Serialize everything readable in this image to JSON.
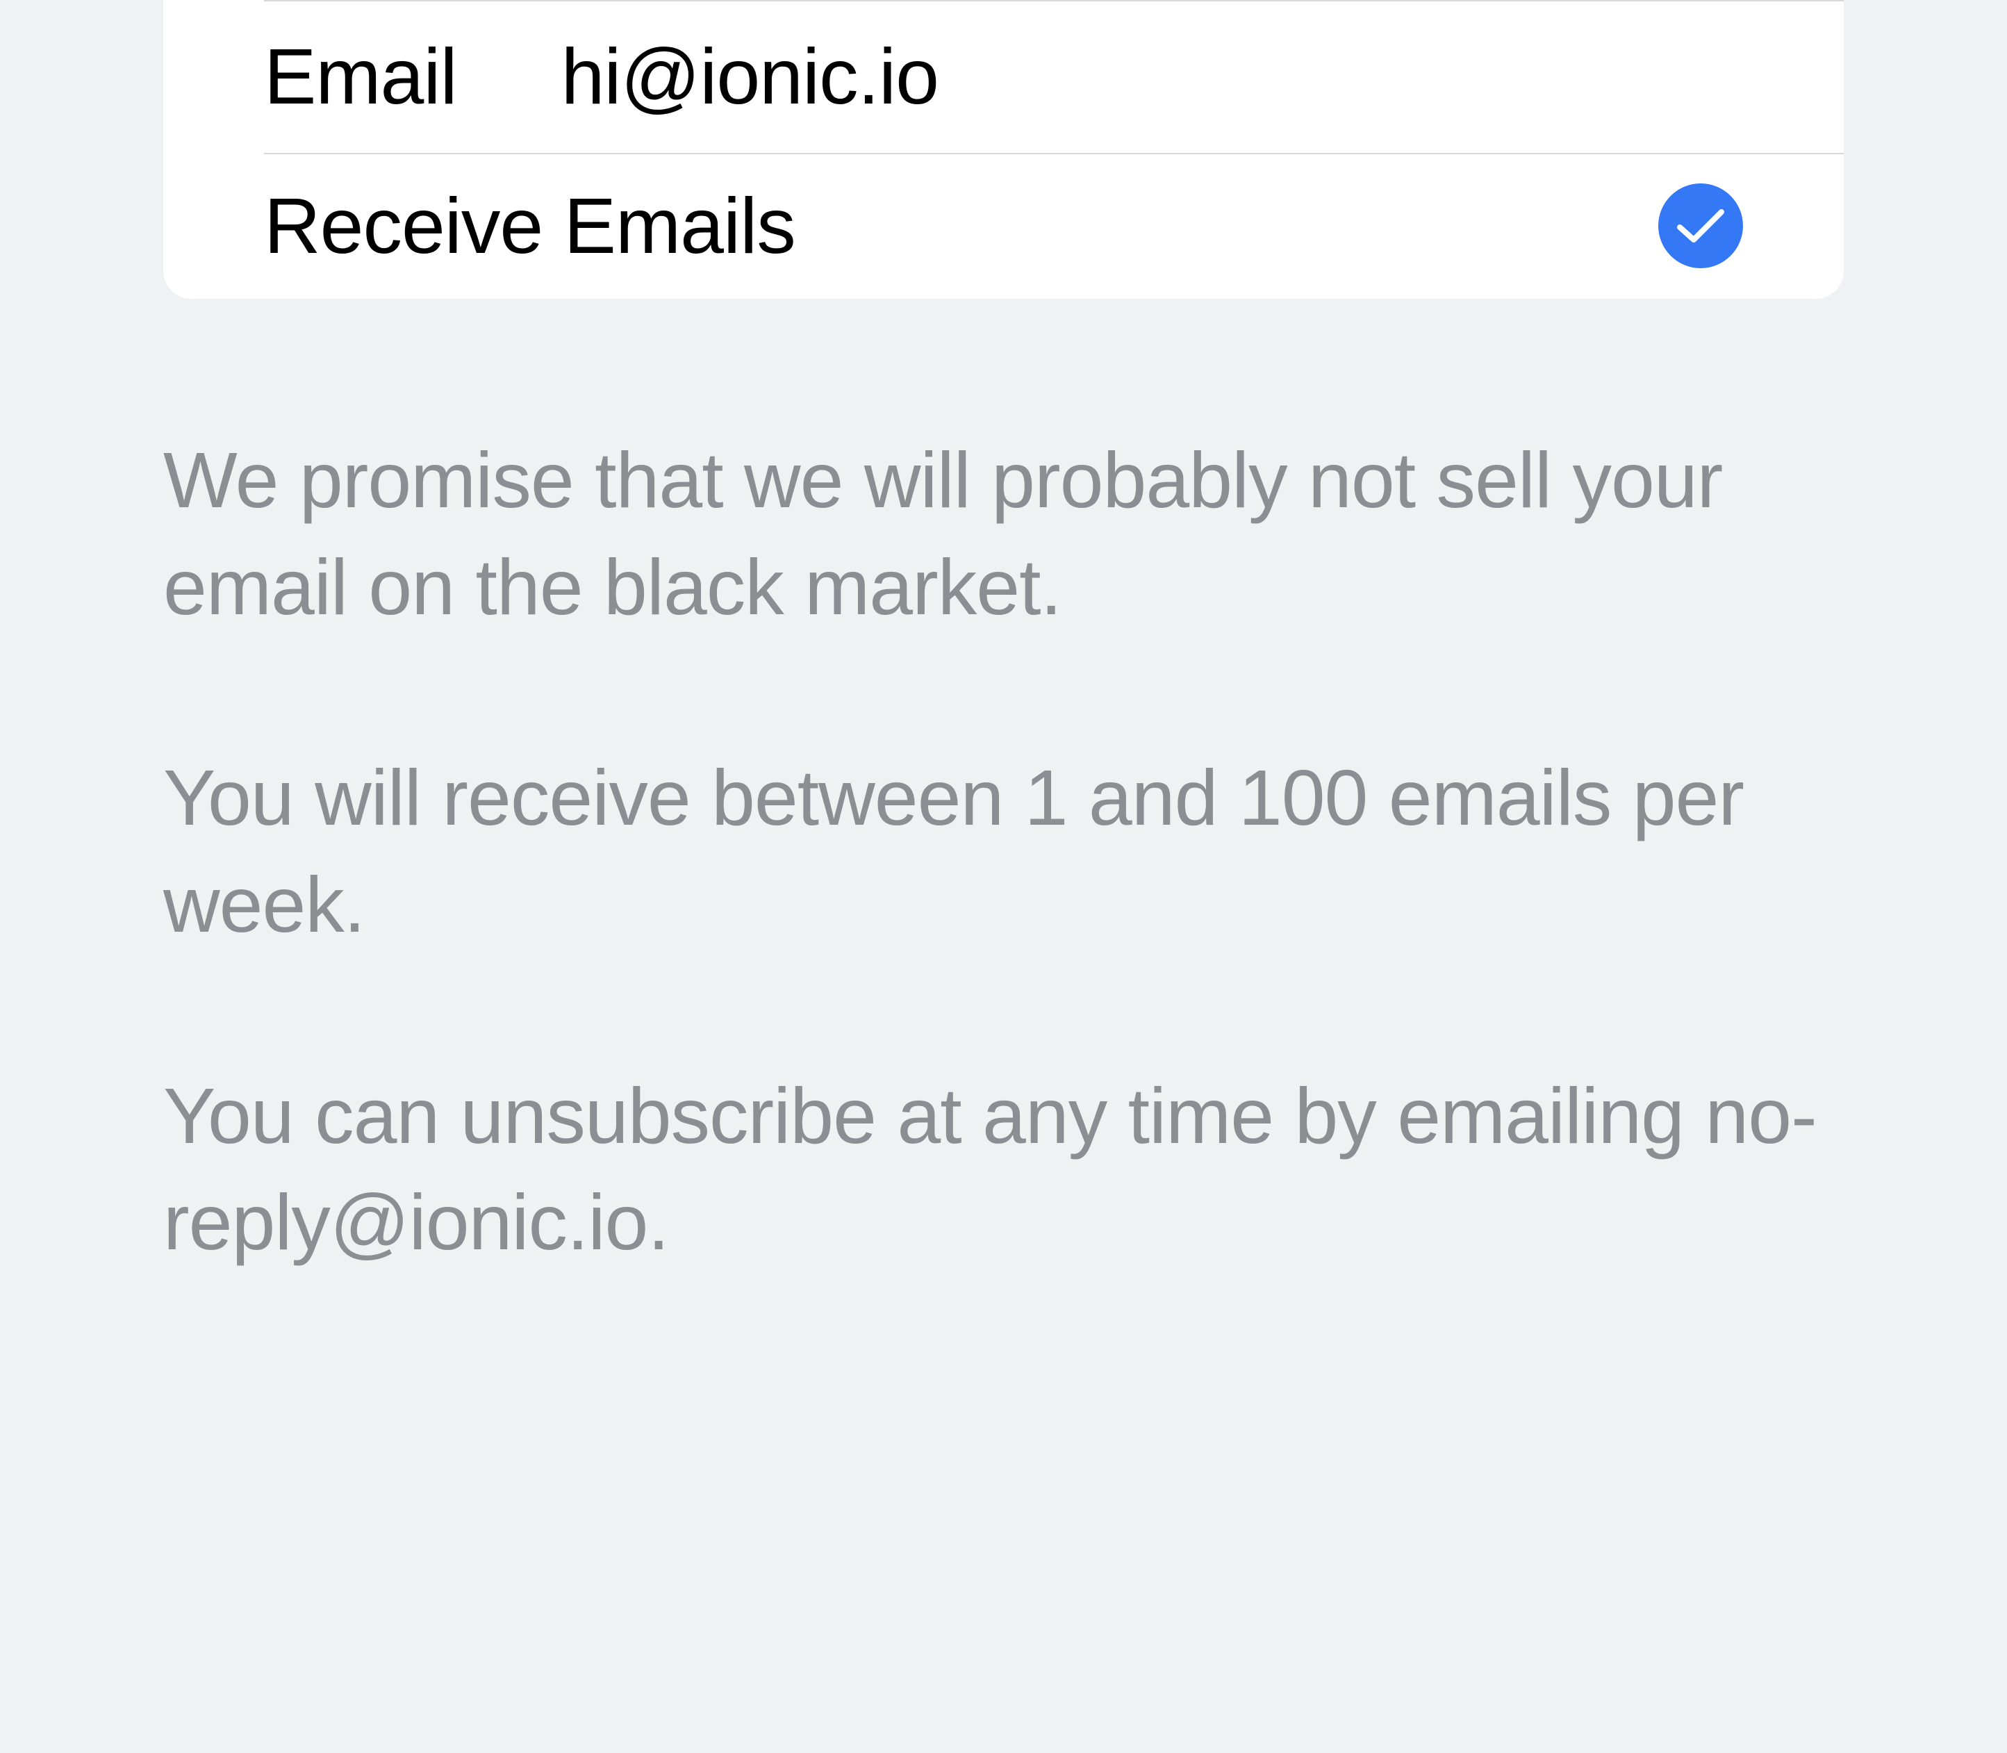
{
  "list": {
    "email_row": {
      "label": "Email",
      "value": "hi@ionic.io"
    },
    "receive_row": {
      "label": "Receive Emails",
      "checked": true
    }
  },
  "footer": {
    "p1": "We promise that we will probably not sell your email on the black market.",
    "p2": "You will receive between 1 and 100 emails per week.",
    "p3": "You can unsubscribe at any time by emailing no-reply@ionic.io."
  }
}
